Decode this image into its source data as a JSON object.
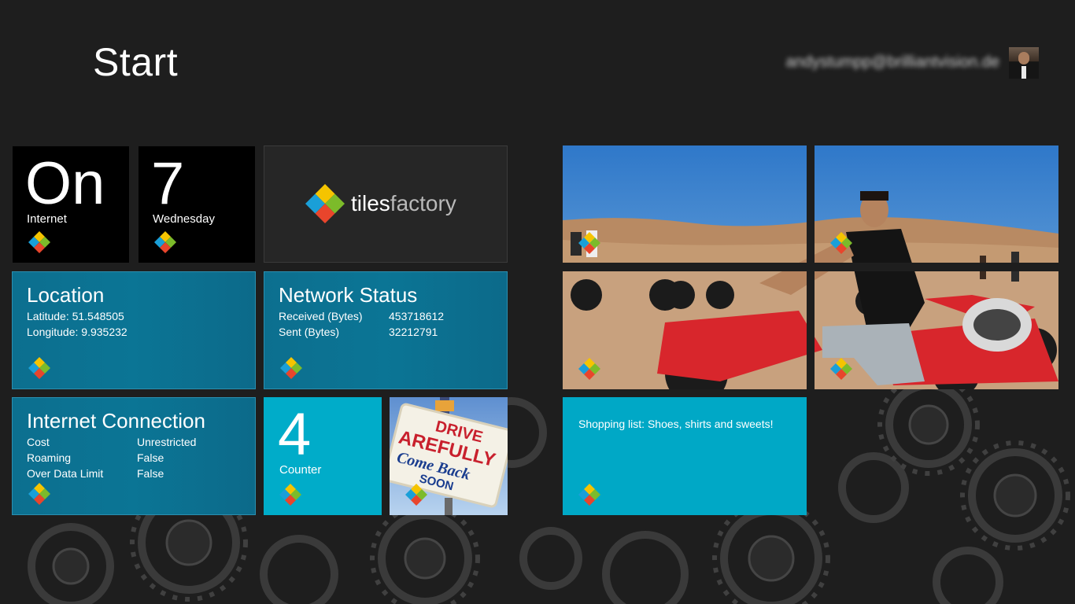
{
  "header": {
    "title": "Start",
    "user_email": "andystumpp@brilliantvision.de"
  },
  "tiles": {
    "internet_status": {
      "value": "On",
      "label": "Internet"
    },
    "date": {
      "value": "7",
      "label": "Wednesday"
    },
    "brand": {
      "word_1": "tiles",
      "word_2": "factory"
    },
    "location": {
      "title": "Location",
      "latitude": "Latitude: 51.548505",
      "longitude": "Longitude: 9.935232"
    },
    "network_status": {
      "title": "Network Status",
      "received_label": "Received (Bytes)",
      "received_value": "453718612",
      "sent_label": "Sent (Bytes)",
      "sent_value": "32212791"
    },
    "internet_connection": {
      "title": "Internet Connection",
      "cost_label": "Cost",
      "cost_value": "Unrestricted",
      "roaming_label": "Roaming",
      "roaming_value": "False",
      "over_limit_label": "Over Data Limit",
      "over_limit_value": "False"
    },
    "counter": {
      "value": "4",
      "label": "Counter"
    },
    "sign_photo": {
      "line1": "DRIVE",
      "line2": "AREFULLY",
      "line3": "Come Back",
      "line4": "SOON"
    },
    "shopping": {
      "text": "Shopping list: Shoes, shirts and sweets!"
    }
  },
  "colors": {
    "background": "#1e1e1e",
    "teal": "#0b7595",
    "cyan": "#00acc9",
    "black_tile": "#000000",
    "logo_yellow": "#f5c400",
    "logo_green": "#7cbb2a",
    "logo_blue": "#1a9fd8",
    "logo_red": "#e8452c"
  },
  "icons": {
    "app_logo": "tilesfactory-logo-icon"
  }
}
